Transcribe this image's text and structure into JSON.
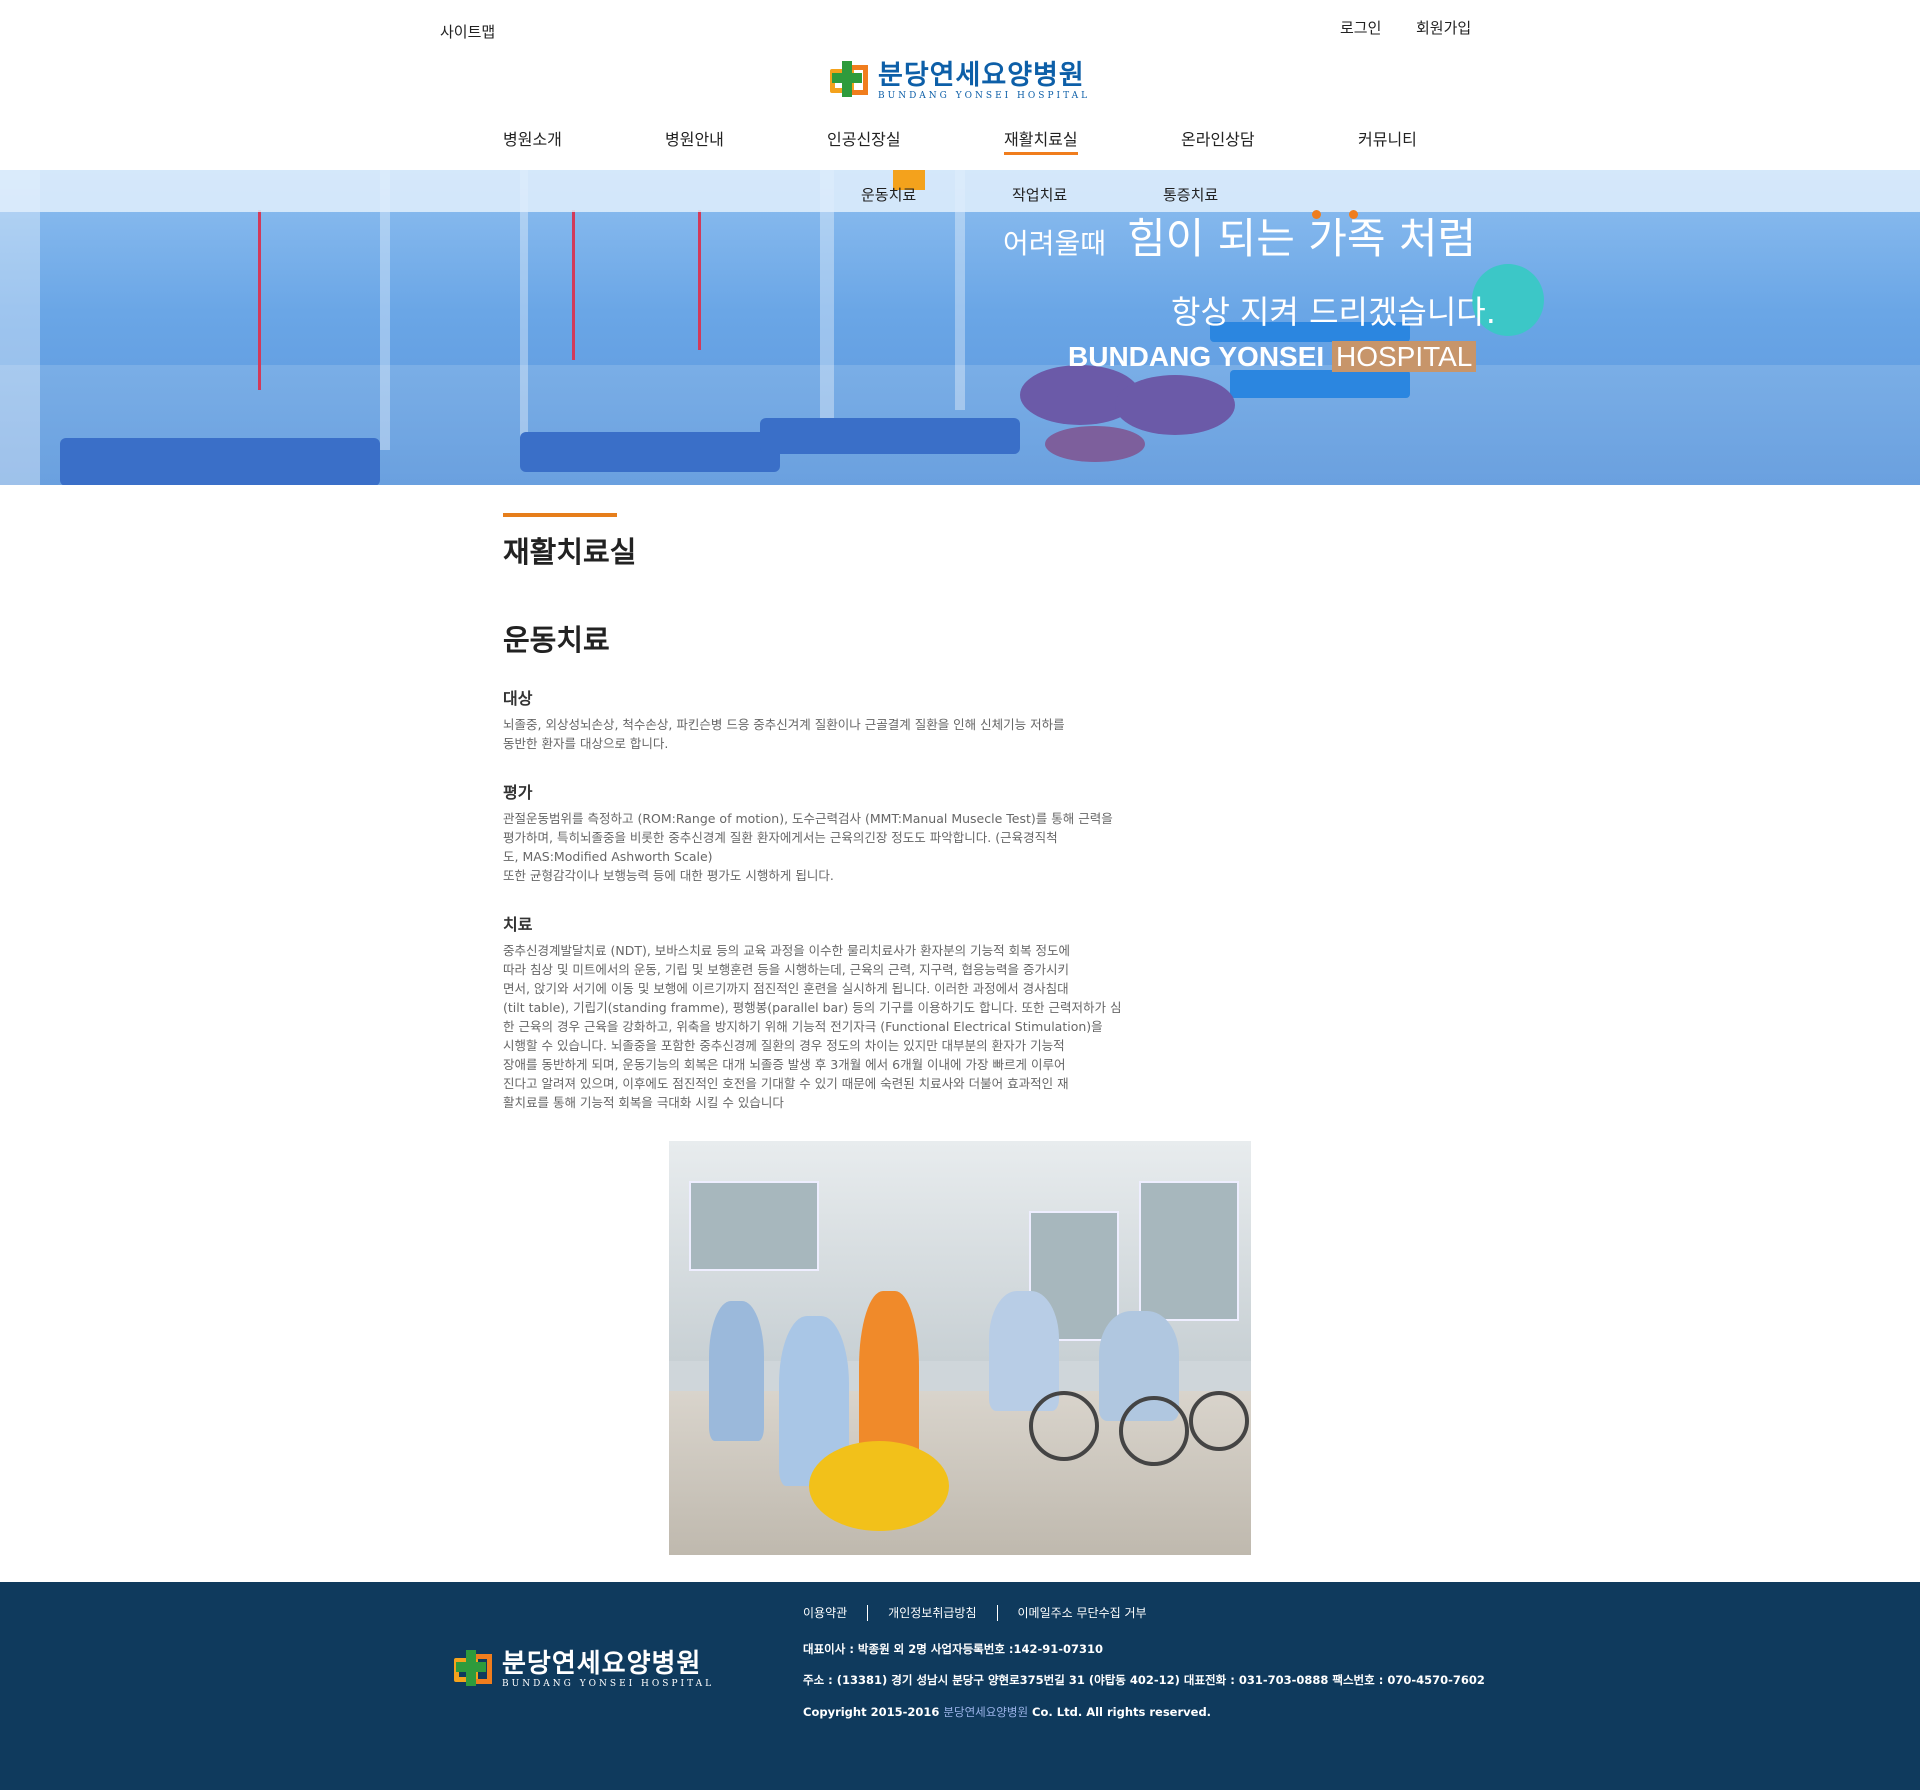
{
  "header": {
    "sitemap": "사이트맵",
    "login": "로그인",
    "join": "회원가입",
    "logo_ko": "분당연세요양병원",
    "logo_en": "BUNDANG YONSEI HOSPITAL",
    "nav": [
      "병원소개",
      "병원안내",
      "인공신장실",
      "재활치료실",
      "온라인상담",
      "커뮤니티"
    ],
    "active_nav": "재활치료실"
  },
  "subnav": {
    "items": [
      "운동치료",
      "작업치료",
      "통증치료"
    ],
    "active": "운동치료"
  },
  "banner": {
    "line1_small": "어려울때",
    "line1_big": "힘이 되는 가족 처럼",
    "line2": "항상 지켜 드리겠습니다.",
    "brand_bold": "BUNDANG YONSEI",
    "brand_light": "HOSPITAL"
  },
  "content": {
    "page_title": "재활치료실",
    "section_title": "운동치료",
    "blocks": [
      {
        "head": "대상",
        "body": "뇌졸중, 외상성뇌손상, 척수손상, 파킨슨병 드응 중추신겨계 질환이나 근골결계 질환을 인해 신체기능 저하를\n동반한 환자를 대상으로 합니다."
      },
      {
        "head": "평가",
        "body": "관절운동범위를 측정하고 (ROM:Range of motion), 도수근력검사 (MMT:Manual Musecle Test)를 통해 근력을\n평가하며, 특히뇌졸중을 비롯한 중추신경계 질환 환자에게서는 근육의긴장 정도도 파악합니다. (근육경직척\n도, MAS:Modified Ashworth Scale)\n또한 균형감각이나 보행능력 등에 대한 평가도 시행하게 됩니다."
      },
      {
        "head": "치료",
        "body": "중추신경계발달치료 (NDT), 보바스치료 등의 교육 과정을 이수한 물리치료사가 환자분의 기능적 회복 정도에\n따라 침상 및 미트에서의 운동, 기립 및 보행훈련 등을 시행하는데, 근육의 근력, 지구력, 협응능력을 증가시키\n면서, 앉기와 서기에 이동 및 보행에 이르기까지 점진적인 훈련을 실시하게 됩니다. 이러한 과정에서 경사침대\n(tilt table), 기립기(standing framme), 평행봉(parallel bar) 등의 기구를 이용하기도 합니다. 또한 근력저하가 심\n한 근육의 경우 근육을 강화하고, 위축을 방지하기 위해 기능적 전기자극 (Functional Electrical Stimulation)을\n시행할 수 있습니다. 뇌졸중을 포함한 중추신경께 질환의 경우 정도의 차이는 있지만 대부분의 환자가 기능적\n장애를 동반하게 되며, 운동기능의 회복은 대개 뇌졸증 발생 후 3개월 에서 6개월 이내에 가장 빠르게 이루어\n진다고 알려져 있으며, 이후에도 점진적인 호전을 기대할 수 있기 때문에 숙련된 치료사와 더불어 효과적인 재\n활치료를 통해 기능적 회복을 극대화 시킬 수 있습니다"
      }
    ]
  },
  "footer": {
    "logo_ko": "분당연세요양병원",
    "logo_en": "BUNDANG YONSEI HOSPITAL",
    "links": [
      "이용약관",
      "개인정보취급방침",
      "이메일주소 무단수집 거부"
    ],
    "line1": "대표이사 : 박종원 외 2명 사업자등록번호 :142-91-07310",
    "line2": "주소 : (13381) 경기 성남시 분당구 양현로375번길 31 (야탑동 402-12)  대표전화 : 031-703-0888  팩스번호 : 070-4570-7602",
    "copy_prefix": "Copyright 2015-2016 ",
    "copy_brand": "분당연세요양병원",
    "copy_suffix": " Co. Ltd. All rights reserved."
  }
}
